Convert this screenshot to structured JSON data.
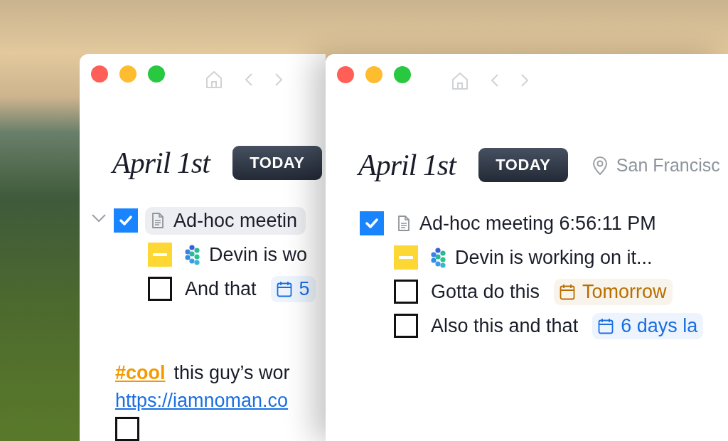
{
  "windows": [
    {
      "title": "April 1st",
      "today_button": "TODAY",
      "tasks": [
        {
          "kind": "note",
          "text": "Ad-hoc meetin",
          "checked": true,
          "in_progress": false,
          "selected": true,
          "expanded": true,
          "children": [
            {
              "kind": "agent",
              "text": "Devin is wo",
              "checked": false,
              "in_progress": true
            },
            {
              "kind": "task",
              "text": "And that",
              "checked": false,
              "in_progress": false,
              "date": {
                "label": "5",
                "color": "#1a6fe0"
              }
            }
          ]
        }
      ],
      "notes": {
        "tag": "#cool",
        "text": "this guy’s wor",
        "link": "https://iamnoman.co",
        "trailing_task": {
          "checked": false
        }
      }
    },
    {
      "title": "April 1st",
      "today_button": "TODAY",
      "location": "San Francisc",
      "tasks": [
        {
          "kind": "note",
          "text": "Ad-hoc meeting 6:56:11 PM",
          "checked": true,
          "in_progress": false,
          "selected": false,
          "children": [
            {
              "kind": "agent",
              "text": "Devin is working on it...",
              "checked": false,
              "in_progress": true
            },
            {
              "kind": "task",
              "text": "Gotta do this",
              "checked": false,
              "in_progress": false,
              "date": {
                "label": "Tomorrow",
                "color": "#b86e00"
              }
            },
            {
              "kind": "task",
              "text": "Also this and that",
              "checked": false,
              "in_progress": false,
              "date": {
                "label": "6 days la",
                "color": "#1a6fe0"
              }
            }
          ]
        }
      ]
    }
  ]
}
